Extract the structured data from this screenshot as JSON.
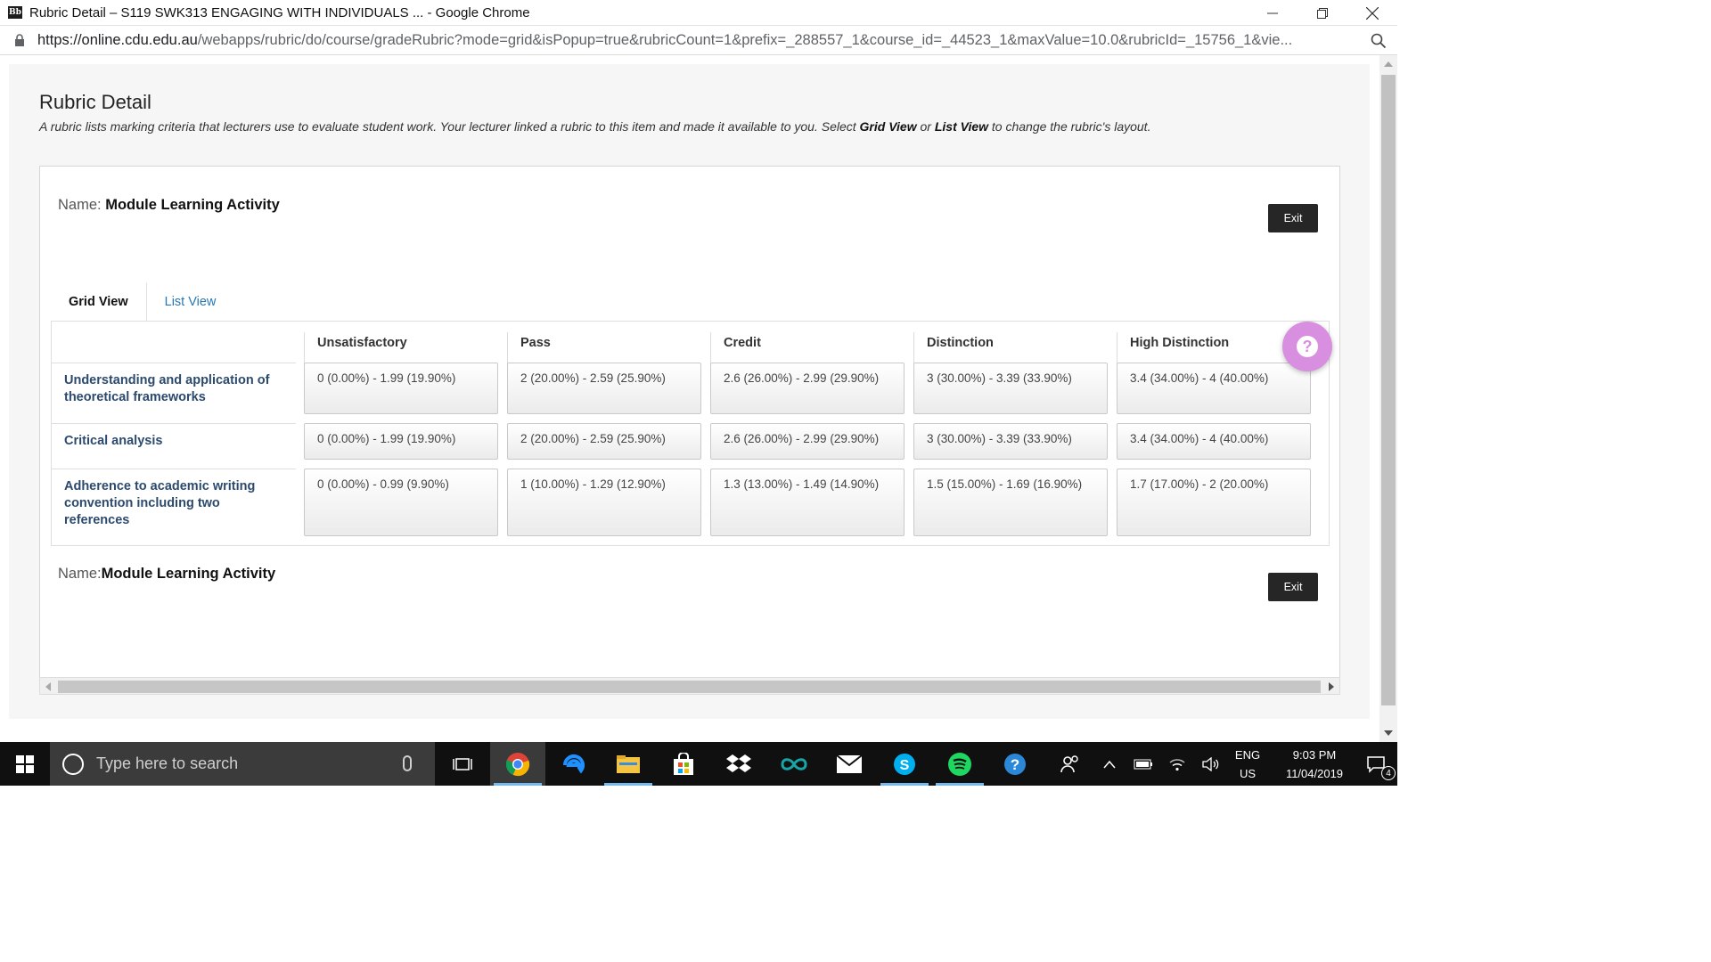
{
  "window": {
    "app_icon_text": "Bb",
    "title": "Rubric Detail – S119 SWK313 ENGAGING WITH INDIVIDUALS ... - Google Chrome"
  },
  "address_bar": {
    "url_host": "https://online.cdu.edu.au",
    "url_path": "/webapps/rubric/do/course/gradeRubric?mode=grid&isPopup=true&rubricCount=1&prefix=_288557_1&course_id=_44523_1&maxValue=10.0&rubricId=_15756_1&vie..."
  },
  "page": {
    "title": "Rubric Detail",
    "description_prefix": "A rubric lists marking criteria that lecturers use to evaluate student work. Your lecturer linked a rubric to this item and made it available to you. Select ",
    "grid_view_link": "Grid View",
    "description_or": " or ",
    "list_view_link": "List View",
    "description_suffix": " to change the rubric's layout."
  },
  "rubric": {
    "name_label_top": "Name:",
    "name_label_bottom": "Name:",
    "name": "Module Learning Activity",
    "exit_label": "Exit",
    "tabs": [
      "Grid View",
      "List View"
    ],
    "active_tab": "Grid View",
    "columns": [
      "Unsatisfactory",
      "Pass",
      "Credit",
      "Distinction",
      "High Distinction"
    ],
    "rows": [
      {
        "criterion": "Understanding and application of theoretical frameworks",
        "cells": [
          "0 (0.00%) - 1.99 (19.90%)",
          "2 (20.00%) - 2.59 (25.90%)",
          "2.6 (26.00%) - 2.99 (29.90%)",
          "3 (30.00%) - 3.39 (33.90%)",
          "3.4 (34.00%) - 4 (40.00%)"
        ]
      },
      {
        "criterion": "Critical analysis",
        "cells": [
          "0 (0.00%) - 1.99 (19.90%)",
          "2 (20.00%) - 2.59 (25.90%)",
          "2.6 (26.00%) - 2.99 (29.90%)",
          "3 (30.00%) - 3.39 (33.90%)",
          "3.4 (34.00%) - 4 (40.00%)"
        ]
      },
      {
        "criterion": "Adherence to academic writing convention including two references",
        "cells": [
          "0 (0.00%) - 0.99 (9.90%)",
          "1 (10.00%) - 1.29 (12.90%)",
          "1.3 (13.00%) - 1.49 (14.90%)",
          "1.5 (15.00%) - 1.69 (16.90%)",
          "1.7 (17.00%) - 2 (20.00%)"
        ]
      }
    ],
    "help_label": "?"
  },
  "taskbar": {
    "search_placeholder": "Type here to search",
    "apps": [
      "task-view",
      "chrome",
      "edge",
      "file-explorer",
      "store",
      "dropbox",
      "arduino",
      "mail",
      "skype",
      "spotify",
      "help"
    ],
    "active_app": "chrome",
    "language_top": "ENG",
    "language_bottom": "US",
    "time": "9:03 PM",
    "date": "11/04/2019",
    "notification_count": "4"
  }
}
